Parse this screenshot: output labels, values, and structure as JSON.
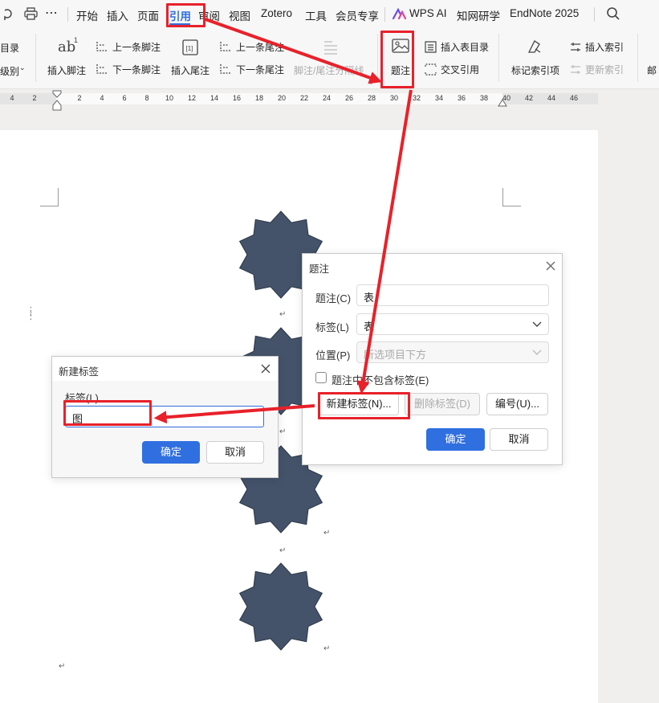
{
  "menubar": {
    "items": [
      "开始",
      "插入",
      "页面",
      "引用",
      "审阅",
      "视图",
      "Zotero",
      "工具",
      "会员专享",
      "WPS AI",
      "知网研学",
      "EndNote 2025"
    ],
    "active_item": "引用",
    "active_color": "#2f6fe0"
  },
  "ribbon": {
    "left_cut_1": "目录",
    "left_cut_2": "级别",
    "insert_footnote": "插入脚注",
    "prev_footnote": "上一条脚注",
    "next_footnote": "下一条脚注",
    "insert_endnote": "插入尾注",
    "prev_endnote": "上一条尾注",
    "next_endnote": "下一条尾注",
    "footnote_separator": "脚注/尾注分隔线",
    "caption": "题注",
    "insert_table_of_figures": "插入表目录",
    "cross_reference": "交叉引用",
    "mark_index_entry": "标记索引项",
    "insert_index": "插入索引",
    "update_index": "更新索引",
    "mail_cut": "邮"
  },
  "ruler": {
    "ticks": [
      "4",
      "2",
      "2",
      "4",
      "6",
      "8",
      "10",
      "12",
      "14",
      "16",
      "18",
      "20",
      "22",
      "24",
      "26",
      "28",
      "30",
      "32",
      "34",
      "36",
      "38",
      "40",
      "42",
      "44",
      "46"
    ]
  },
  "document": {
    "shape_color": "#44536a",
    "para_mark": "↵"
  },
  "caption_dialog": {
    "title": "题注",
    "caption_label": "题注(C)",
    "caption_value": "表",
    "label_label": "标签(L)",
    "label_value": "表",
    "position_label": "位置(P)",
    "position_value": "所选项目下方",
    "exclude_checkbox": "题注中不包含标签(E)",
    "new_label_button": "新建标签(N)...",
    "delete_label_button": "删除标签(D)",
    "numbering_button": "编号(U)...",
    "ok_button": "确定",
    "cancel_button": "取消"
  },
  "new_label_dialog": {
    "title": "新建标签",
    "label_field_label": "标签(L)",
    "label_value": "图",
    "ok_button": "确定",
    "cancel_button": "取消"
  },
  "annotation_color": "#e8212a"
}
